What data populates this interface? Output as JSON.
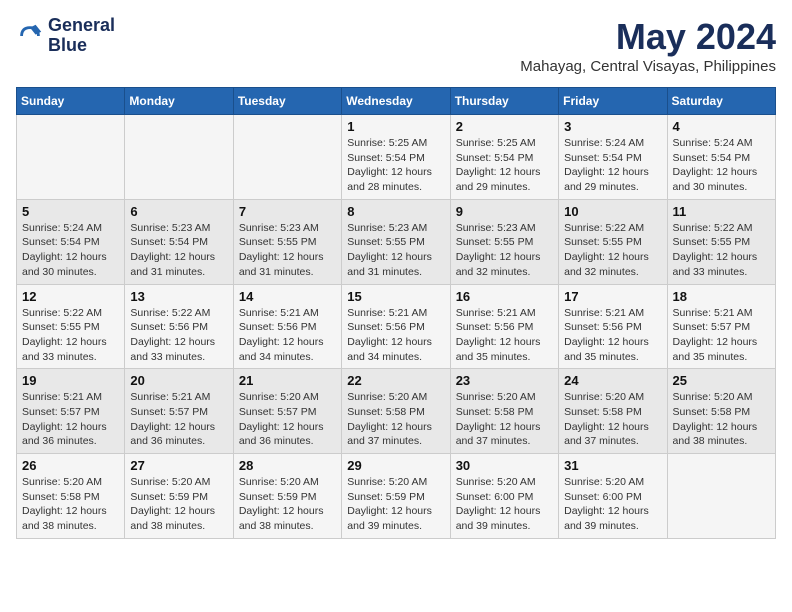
{
  "logo": {
    "line1": "General",
    "line2": "Blue"
  },
  "title": "May 2024",
  "subtitle": "Mahayag, Central Visayas, Philippines",
  "days_of_week": [
    "Sunday",
    "Monday",
    "Tuesday",
    "Wednesday",
    "Thursday",
    "Friday",
    "Saturday"
  ],
  "weeks": [
    [
      {
        "day": "",
        "info": ""
      },
      {
        "day": "",
        "info": ""
      },
      {
        "day": "",
        "info": ""
      },
      {
        "day": "1",
        "info": "Sunrise: 5:25 AM\nSunset: 5:54 PM\nDaylight: 12 hours and 28 minutes."
      },
      {
        "day": "2",
        "info": "Sunrise: 5:25 AM\nSunset: 5:54 PM\nDaylight: 12 hours and 29 minutes."
      },
      {
        "day": "3",
        "info": "Sunrise: 5:24 AM\nSunset: 5:54 PM\nDaylight: 12 hours and 29 minutes."
      },
      {
        "day": "4",
        "info": "Sunrise: 5:24 AM\nSunset: 5:54 PM\nDaylight: 12 hours and 30 minutes."
      }
    ],
    [
      {
        "day": "5",
        "info": "Sunrise: 5:24 AM\nSunset: 5:54 PM\nDaylight: 12 hours and 30 minutes."
      },
      {
        "day": "6",
        "info": "Sunrise: 5:23 AM\nSunset: 5:54 PM\nDaylight: 12 hours and 31 minutes."
      },
      {
        "day": "7",
        "info": "Sunrise: 5:23 AM\nSunset: 5:55 PM\nDaylight: 12 hours and 31 minutes."
      },
      {
        "day": "8",
        "info": "Sunrise: 5:23 AM\nSunset: 5:55 PM\nDaylight: 12 hours and 31 minutes."
      },
      {
        "day": "9",
        "info": "Sunrise: 5:23 AM\nSunset: 5:55 PM\nDaylight: 12 hours and 32 minutes."
      },
      {
        "day": "10",
        "info": "Sunrise: 5:22 AM\nSunset: 5:55 PM\nDaylight: 12 hours and 32 minutes."
      },
      {
        "day": "11",
        "info": "Sunrise: 5:22 AM\nSunset: 5:55 PM\nDaylight: 12 hours and 33 minutes."
      }
    ],
    [
      {
        "day": "12",
        "info": "Sunrise: 5:22 AM\nSunset: 5:55 PM\nDaylight: 12 hours and 33 minutes."
      },
      {
        "day": "13",
        "info": "Sunrise: 5:22 AM\nSunset: 5:56 PM\nDaylight: 12 hours and 33 minutes."
      },
      {
        "day": "14",
        "info": "Sunrise: 5:21 AM\nSunset: 5:56 PM\nDaylight: 12 hours and 34 minutes."
      },
      {
        "day": "15",
        "info": "Sunrise: 5:21 AM\nSunset: 5:56 PM\nDaylight: 12 hours and 34 minutes."
      },
      {
        "day": "16",
        "info": "Sunrise: 5:21 AM\nSunset: 5:56 PM\nDaylight: 12 hours and 35 minutes."
      },
      {
        "day": "17",
        "info": "Sunrise: 5:21 AM\nSunset: 5:56 PM\nDaylight: 12 hours and 35 minutes."
      },
      {
        "day": "18",
        "info": "Sunrise: 5:21 AM\nSunset: 5:57 PM\nDaylight: 12 hours and 35 minutes."
      }
    ],
    [
      {
        "day": "19",
        "info": "Sunrise: 5:21 AM\nSunset: 5:57 PM\nDaylight: 12 hours and 36 minutes."
      },
      {
        "day": "20",
        "info": "Sunrise: 5:21 AM\nSunset: 5:57 PM\nDaylight: 12 hours and 36 minutes."
      },
      {
        "day": "21",
        "info": "Sunrise: 5:20 AM\nSunset: 5:57 PM\nDaylight: 12 hours and 36 minutes."
      },
      {
        "day": "22",
        "info": "Sunrise: 5:20 AM\nSunset: 5:58 PM\nDaylight: 12 hours and 37 minutes."
      },
      {
        "day": "23",
        "info": "Sunrise: 5:20 AM\nSunset: 5:58 PM\nDaylight: 12 hours and 37 minutes."
      },
      {
        "day": "24",
        "info": "Sunrise: 5:20 AM\nSunset: 5:58 PM\nDaylight: 12 hours and 37 minutes."
      },
      {
        "day": "25",
        "info": "Sunrise: 5:20 AM\nSunset: 5:58 PM\nDaylight: 12 hours and 38 minutes."
      }
    ],
    [
      {
        "day": "26",
        "info": "Sunrise: 5:20 AM\nSunset: 5:58 PM\nDaylight: 12 hours and 38 minutes."
      },
      {
        "day": "27",
        "info": "Sunrise: 5:20 AM\nSunset: 5:59 PM\nDaylight: 12 hours and 38 minutes."
      },
      {
        "day": "28",
        "info": "Sunrise: 5:20 AM\nSunset: 5:59 PM\nDaylight: 12 hours and 38 minutes."
      },
      {
        "day": "29",
        "info": "Sunrise: 5:20 AM\nSunset: 5:59 PM\nDaylight: 12 hours and 39 minutes."
      },
      {
        "day": "30",
        "info": "Sunrise: 5:20 AM\nSunset: 6:00 PM\nDaylight: 12 hours and 39 minutes."
      },
      {
        "day": "31",
        "info": "Sunrise: 5:20 AM\nSunset: 6:00 PM\nDaylight: 12 hours and 39 minutes."
      },
      {
        "day": "",
        "info": ""
      }
    ]
  ]
}
